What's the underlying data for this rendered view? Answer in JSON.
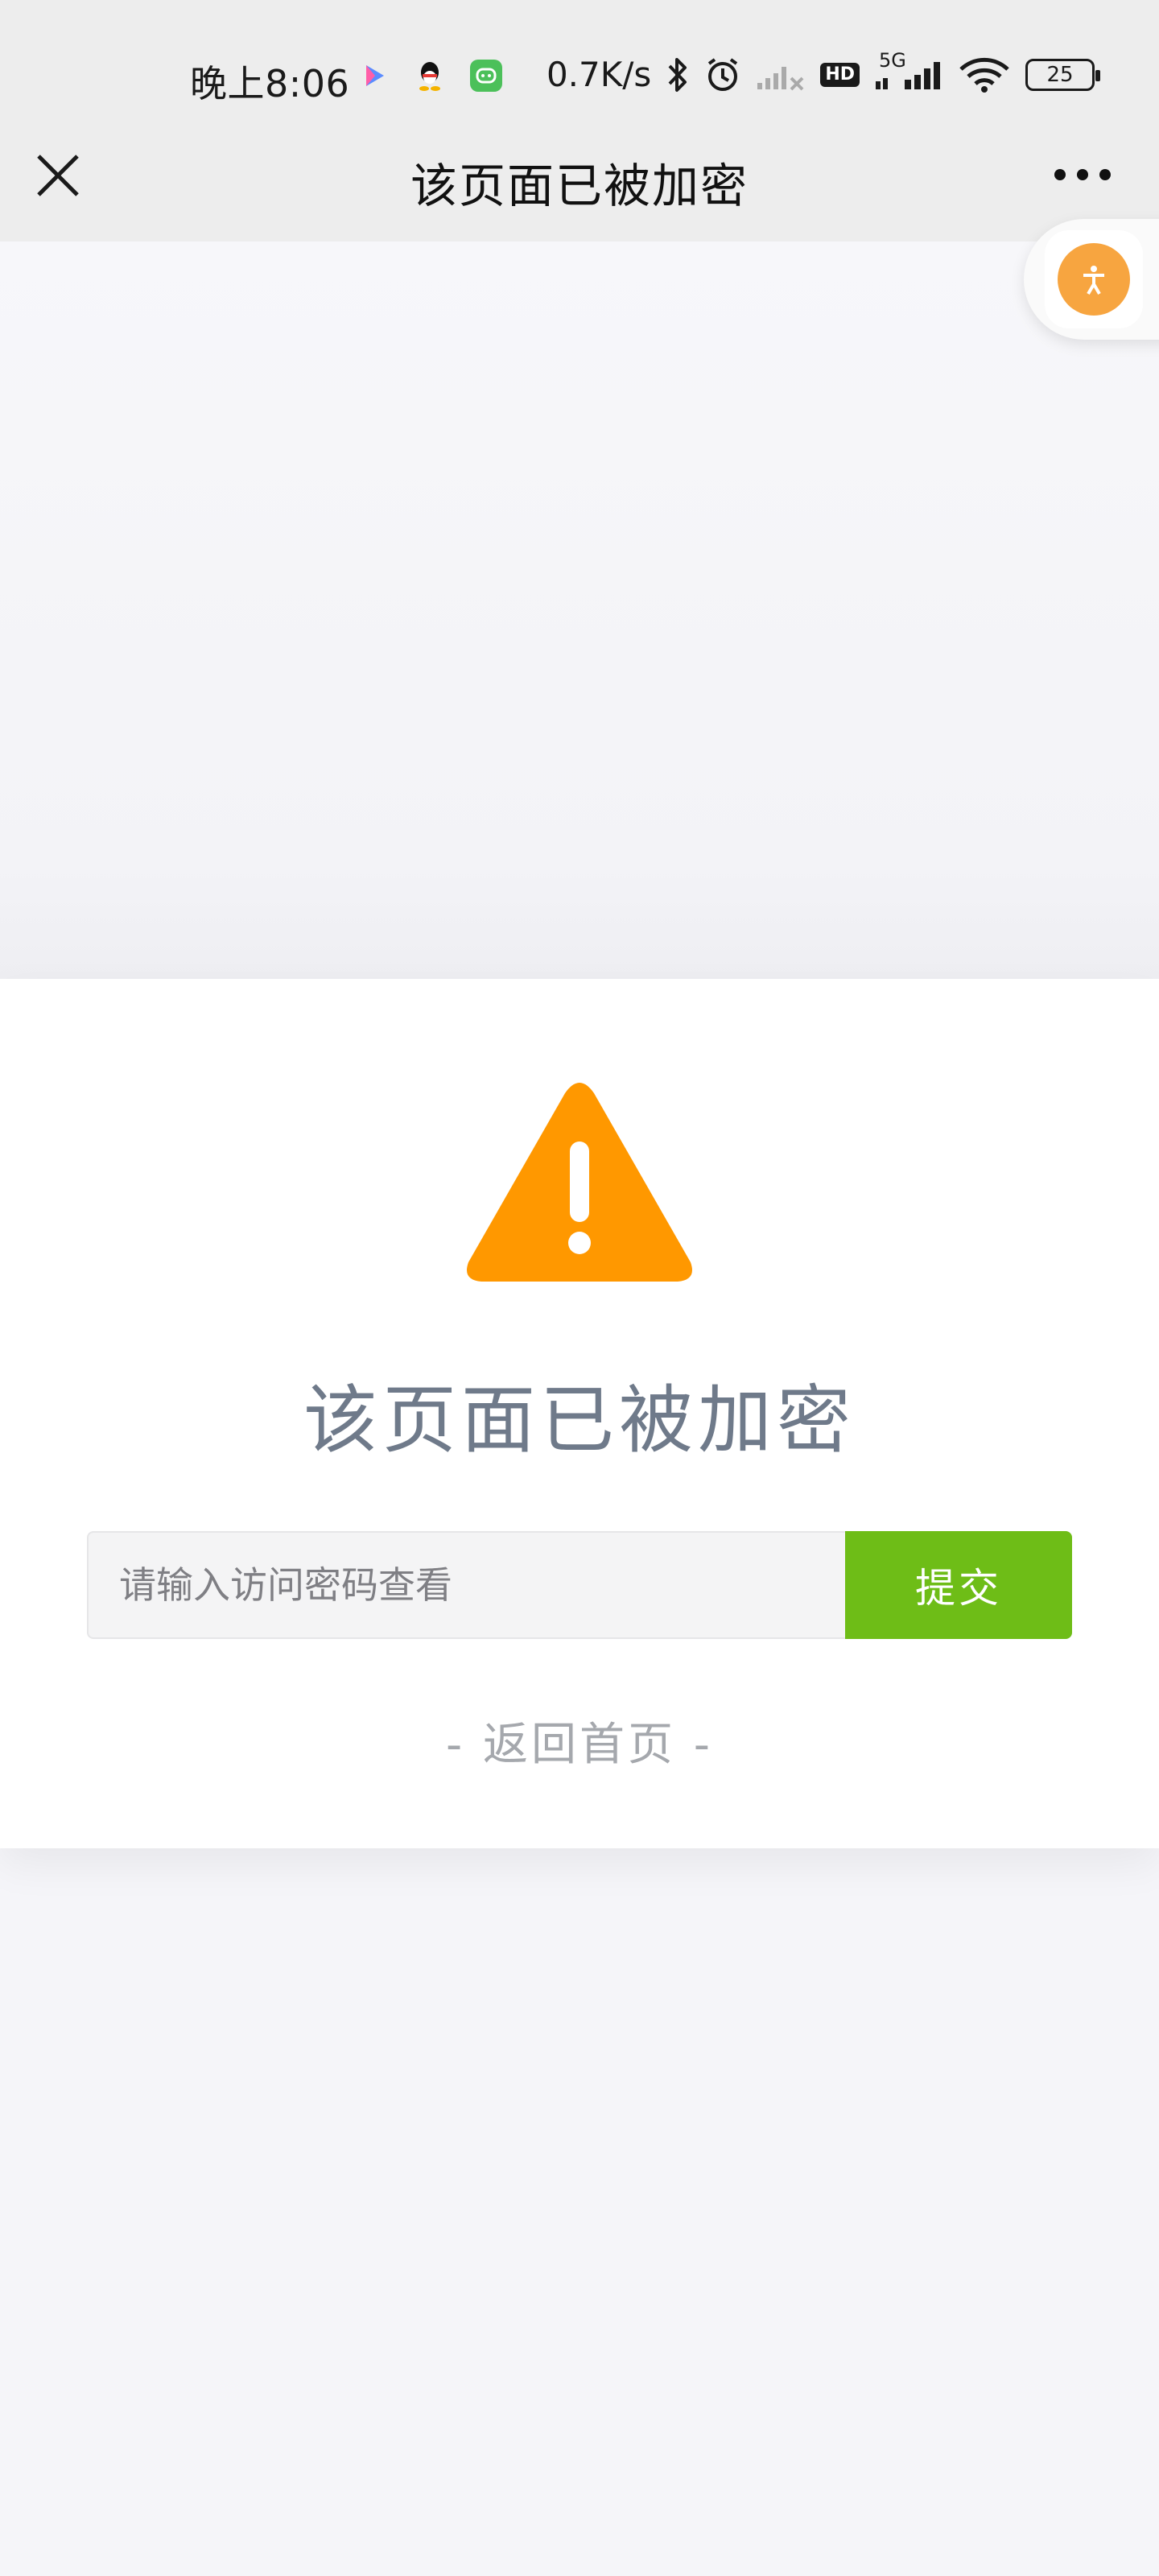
{
  "status_bar": {
    "time": "晚上8:06",
    "network_speed": "0.7K/s",
    "hd_badge": "HD",
    "network_type": "5G",
    "battery": "25"
  },
  "nav": {
    "title": "该页面已被加密"
  },
  "card": {
    "title": "该页面已被加密",
    "password_placeholder": "请输入访问密码查看",
    "password_value": "",
    "submit_label": "提交",
    "back_home": "- 返回首页 -"
  },
  "icons": {
    "close": "close-icon",
    "more": "more-icon",
    "accessibility": "accessibility-icon",
    "warning": "warning-icon",
    "bluetooth": "bluetooth-icon",
    "alarm": "alarm-icon",
    "signal": "signal-icon",
    "wifi": "wifi-icon"
  },
  "colors": {
    "warning": "#ff9800",
    "submit": "#6ebd17",
    "title": "#6f7a8a",
    "accessibility": "#f7a540"
  }
}
